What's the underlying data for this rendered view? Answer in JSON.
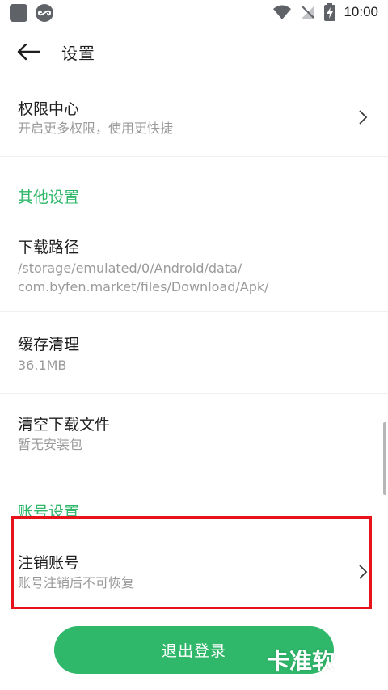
{
  "status_bar": {
    "time": "10:00",
    "icons": [
      "app-square-icon",
      "infinity-app-icon",
      "wifi-icon",
      "no-signal-icon",
      "battery-charging-icon"
    ]
  },
  "header": {
    "title": "设置",
    "back_icon": "arrow-left-icon"
  },
  "rows": {
    "permissions": {
      "title": "权限中心",
      "subtitle": "开启更多权限，使用更快捷"
    },
    "other_section": "其他设置",
    "download_path": {
      "title": "下载路径",
      "subtitle": "/storage/emulated/0/Android/data/\ncom.byfen.market/files/Download/Apk/"
    },
    "cache": {
      "title": "缓存清理",
      "subtitle": "36.1MB"
    },
    "clear_downloads": {
      "title": "清空下载文件",
      "subtitle": "暂无安装包"
    },
    "account_section": "账号设置",
    "cancel_account": {
      "title": "注销账号",
      "subtitle": "账号注销后不可恢复"
    }
  },
  "logout_button": "退出登录",
  "watermark": "卡准软",
  "colors": {
    "accent": "#2fb76a",
    "highlight": "#e8121a",
    "subtitle": "#9a9a9a"
  }
}
